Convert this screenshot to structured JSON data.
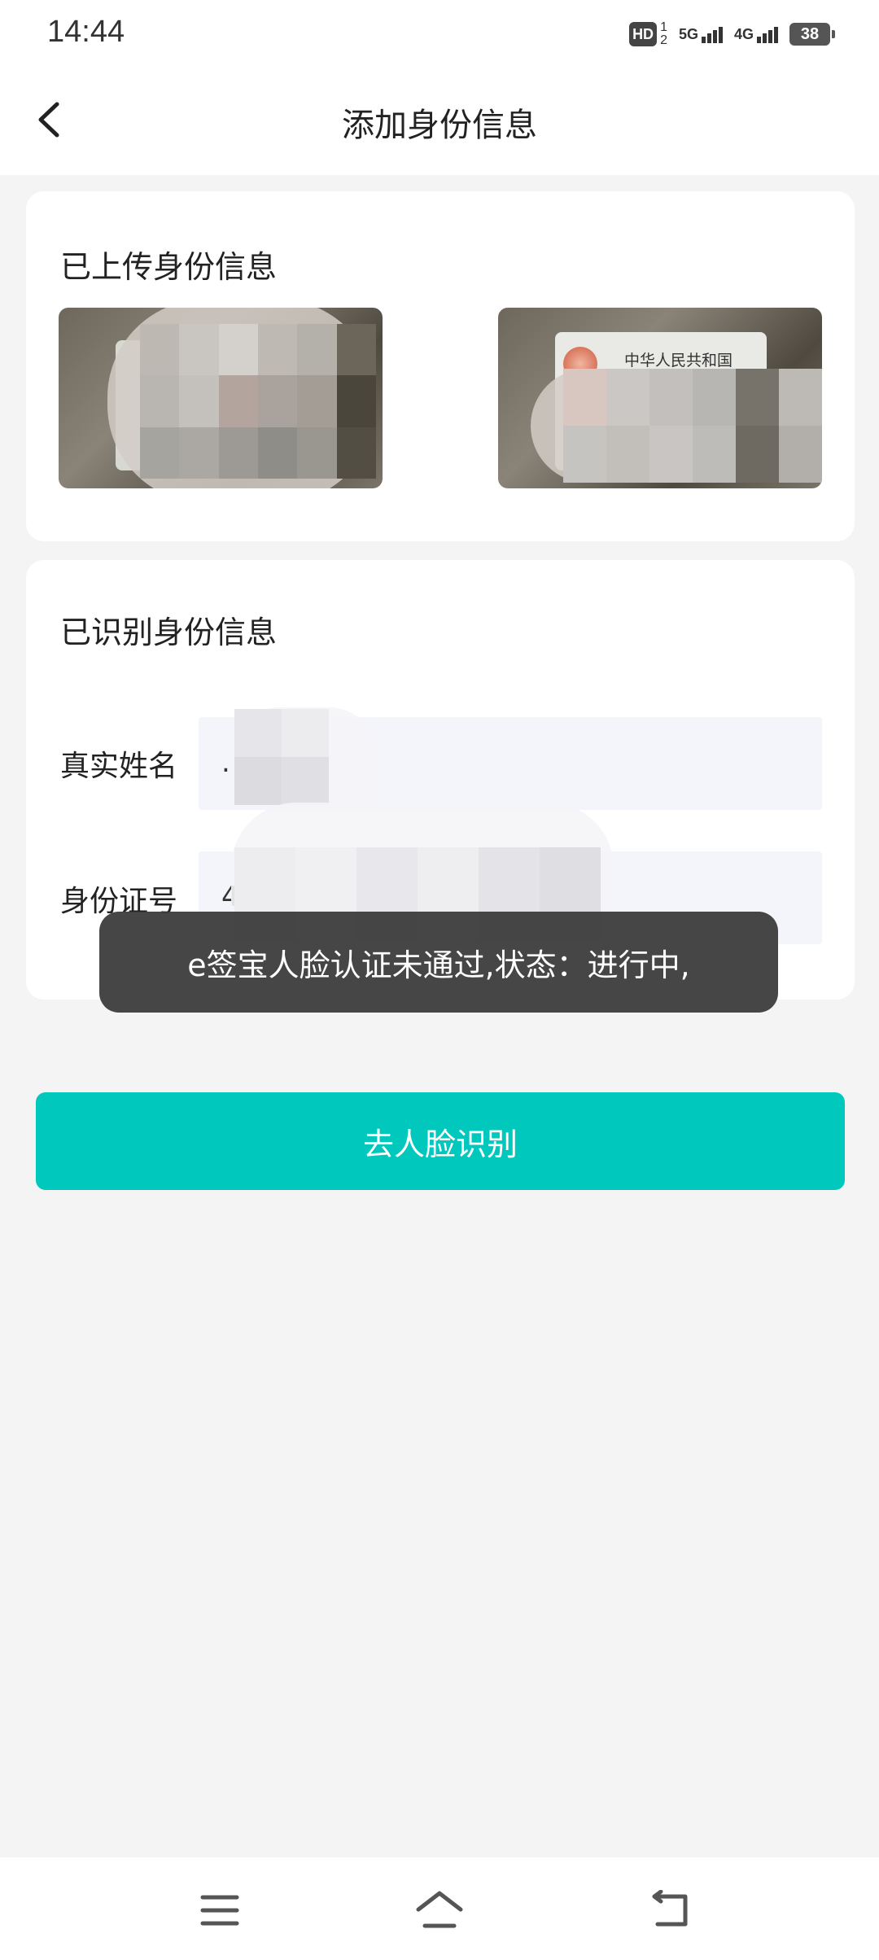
{
  "status_bar": {
    "time": "14:44",
    "hd_label": "HD",
    "sim_top": "1",
    "sim_bottom": "2",
    "net1": "5G",
    "net2": "4G",
    "battery": "38"
  },
  "header": {
    "title": "添加身份信息"
  },
  "upload_section": {
    "title": "已上传身份信息",
    "back_card_text": "中华人民共和国"
  },
  "identity_section": {
    "title": "已识别身份信息",
    "name_label": "真实姓名",
    "name_value": ".",
    "id_label": "身份证号",
    "id_value": "44"
  },
  "toast": {
    "message": "e签宝人脸认证未通过,状态：进行中,"
  },
  "actions": {
    "face_recognition_button": "去人脸识别"
  },
  "colors": {
    "accent": "#00c8bd",
    "toast_bg": "#3c3c3c",
    "page_bg": "#f4f4f4"
  }
}
